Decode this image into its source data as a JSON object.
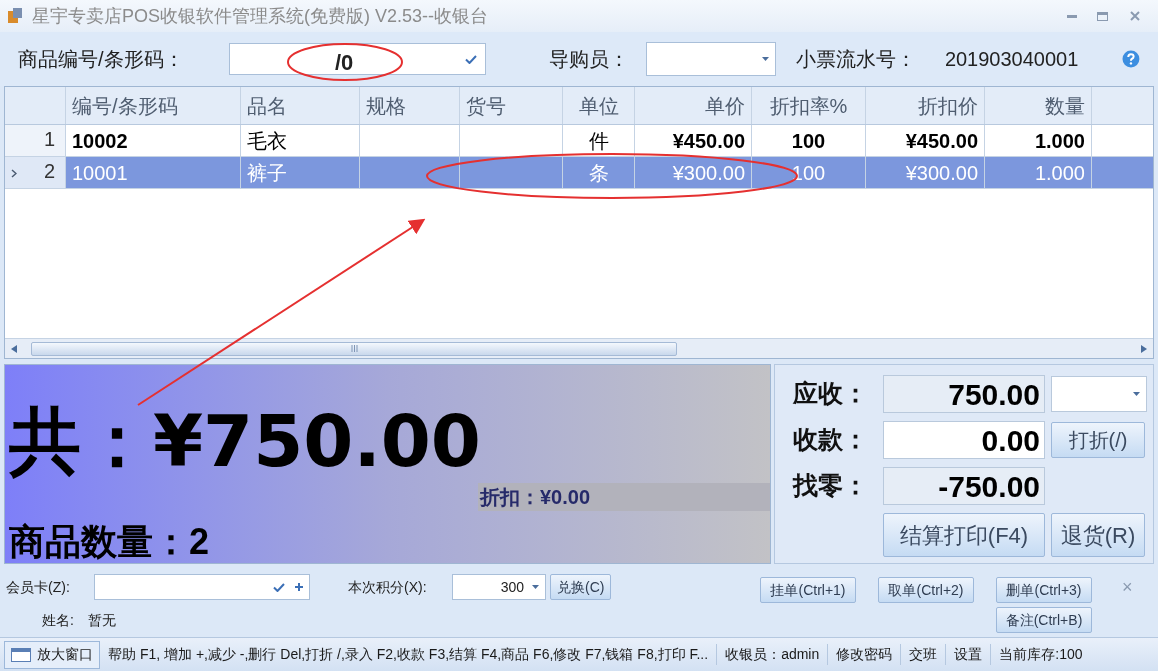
{
  "window": {
    "title": "星宇专卖店POS收银软件管理系统(免费版) V2.53--收银台"
  },
  "toolbar": {
    "barcode_label": "商品编号/条形码：",
    "barcode_value": "/0",
    "guide_label": "导购员：",
    "ticket_label": "小票流水号：",
    "ticket_number": "201903040001"
  },
  "table": {
    "columns": [
      "编号/条形码",
      "品名",
      "规格",
      "货号",
      "单位",
      "单价",
      "折扣率%",
      "折扣价",
      "数量"
    ],
    "rows": [
      {
        "index": "1",
        "selected": false,
        "cells": [
          "10002",
          "毛衣",
          "",
          "",
          "件",
          "¥450.00",
          "100",
          "¥450.00",
          "1.000"
        ]
      },
      {
        "index": "2",
        "selected": true,
        "cells": [
          "10001",
          "裤子",
          "",
          "",
          "条",
          "¥300.00",
          "100",
          "¥300.00",
          "1.000"
        ]
      }
    ]
  },
  "summary": {
    "total": "共：¥750.00",
    "discount": "折扣：¥0.00",
    "count": "商品数量：2"
  },
  "payment": {
    "rows": [
      {
        "label": "应收：",
        "value": "750.00",
        "kind": "readonly"
      },
      {
        "label": "收款：",
        "value": "0.00",
        "kind": "input"
      },
      {
        "label": "找零：",
        "value": "-750.00",
        "kind": "readonly"
      }
    ],
    "discount_button": "打折(/)",
    "checkout_button": "结算打印(F4)",
    "return_button": "退货(R)"
  },
  "member": {
    "card_label": "会员卡(Z):",
    "points_label": "本次积分(X):",
    "points_value": "300",
    "exchange_button": "兑换(C)",
    "name_label": "姓名:",
    "name_value": "暂无",
    "buttons": [
      "挂单(Ctrl+1)",
      "取单(Ctrl+2)",
      "删单(Ctrl+3)",
      "备注(Ctrl+B)"
    ],
    "close": "×"
  },
  "status_bar": {
    "enlarge_button": "放大窗口",
    "items": [
      "帮助 F1, 增加 +,减少 -,删行 Del,打折 /,录入 F2,收款 F3,结算 F4,商品 F6,修改 F7,钱箱 F8,打印 F...",
      "收银员：admin",
      "修改密码",
      "交班",
      "设置",
      "当前库存:100"
    ]
  }
}
